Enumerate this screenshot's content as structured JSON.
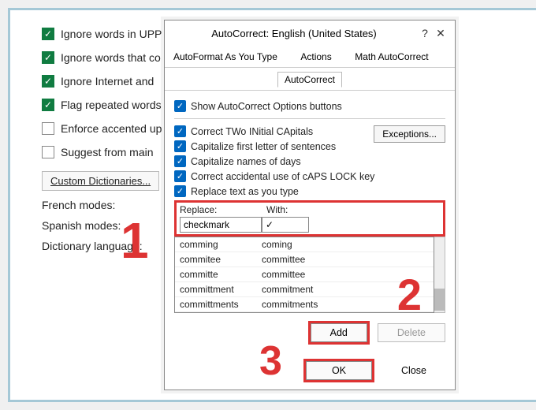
{
  "background": {
    "opts": [
      {
        "checked": true,
        "label": "Ignore words in UPP"
      },
      {
        "checked": true,
        "label": "Ignore words that co"
      },
      {
        "checked": true,
        "label": "Ignore Internet and "
      },
      {
        "checked": true,
        "label": "Flag repeated words"
      },
      {
        "checked": false,
        "label": "Enforce accented up"
      },
      {
        "checked": false,
        "label": "Suggest from main "
      }
    ],
    "custom_dict_btn": "Custom Dictionaries...",
    "field_labels": [
      "French modes:",
      "Spanish modes:",
      "Dictionary language:"
    ]
  },
  "dialog": {
    "title": "AutoCorrect: English (United States)",
    "help": "?",
    "close": "✕",
    "tabs": [
      "AutoFormat As You Type",
      "Actions",
      "Math AutoCorrect"
    ],
    "active_subtab": "AutoCorrect",
    "show_buttons": "Show AutoCorrect Options buttons",
    "exceptions_btn": "Exceptions...",
    "correct_opts": [
      "Correct TWo INitial CApitals",
      "Capitalize first letter of sentences",
      "Capitalize names of days",
      "Correct accidental use of cAPS LOCK key",
      "Replace text as you type"
    ],
    "replace_label": "Replace:",
    "with_label": "With:",
    "replace_value": "checkmark",
    "with_value": "✓",
    "list": [
      {
        "from": "comming",
        "to": "coming"
      },
      {
        "from": "commitee",
        "to": "committee"
      },
      {
        "from": "committe",
        "to": "committee"
      },
      {
        "from": "committment",
        "to": "commitment"
      },
      {
        "from": "committments",
        "to": "commitments"
      }
    ],
    "add_btn": "Add",
    "delete_btn": "Delete",
    "ok_btn": "OK",
    "close_btn": "Close"
  },
  "annotations": {
    "one": "1",
    "two": "2",
    "three": "3"
  }
}
